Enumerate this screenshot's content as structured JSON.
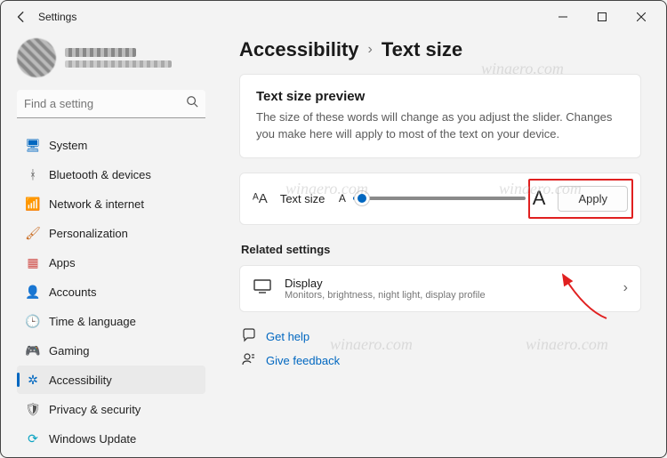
{
  "titlebar": {
    "app_title": "Settings"
  },
  "search": {
    "placeholder": "Find a setting"
  },
  "sidebar": {
    "items": [
      {
        "label": "System",
        "icon_color": "#0067c0",
        "glyph": "🖥"
      },
      {
        "label": "Bluetooth & devices",
        "icon_color": "#555",
        "glyph": "ᚼ"
      },
      {
        "label": "Network & internet",
        "icon_color": "#0aa3c2",
        "glyph": "📶"
      },
      {
        "label": "Personalization",
        "icon_color": "#c8691e",
        "glyph": "🖌"
      },
      {
        "label": "Apps",
        "icon_color": "#d0504b",
        "glyph": "▦"
      },
      {
        "label": "Accounts",
        "icon_color": "#2aa76a",
        "glyph": "👤"
      },
      {
        "label": "Time & language",
        "icon_color": "#555",
        "glyph": "🕒"
      },
      {
        "label": "Gaming",
        "icon_color": "#3aa754",
        "glyph": "🎮"
      },
      {
        "label": "Accessibility",
        "icon_color": "#0067c0",
        "glyph": "✲"
      },
      {
        "label": "Privacy & security",
        "icon_color": "#555",
        "glyph": "🛡"
      },
      {
        "label": "Windows Update",
        "icon_color": "#0aa3c2",
        "glyph": "⟳"
      }
    ],
    "active_index": 8
  },
  "breadcrumb": {
    "parent": "Accessibility",
    "current": "Text size"
  },
  "preview_card": {
    "title": "Text size preview",
    "body": "The size of these words will change as you adjust the slider. Changes you make here will apply to most of the text on your device."
  },
  "slider": {
    "icon_glyph": "ᴬA",
    "label": "Text size",
    "small_a": "A",
    "big_a": "A",
    "apply_label": "Apply",
    "value_percent": 5
  },
  "related": {
    "heading": "Related settings",
    "display": {
      "title": "Display",
      "subtitle": "Monitors, brightness, night light, display profile"
    }
  },
  "links": {
    "help": "Get help",
    "feedback": "Give feedback"
  },
  "watermark": "winaero.com"
}
